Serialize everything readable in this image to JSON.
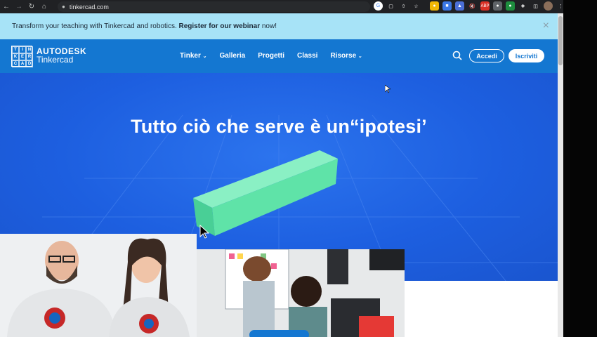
{
  "browser": {
    "url": "tinkercad.com",
    "back_icon": "arrow-left-icon",
    "forward_icon": "arrow-right-icon",
    "reload_icon": "reload-icon",
    "home_icon": "home-icon"
  },
  "banner": {
    "text_before": "Transform your teaching with Tinkercad and robotics. ",
    "link_text": "Register for our webinar",
    "text_after": " now!",
    "close_label": "×"
  },
  "navbar": {
    "logo_letters": [
      "TIN",
      "KER",
      "CAD"
    ],
    "brand_line1": "AUTODESK",
    "brand_line2": "Tinkercad",
    "menu": [
      {
        "label": "Tinker",
        "dropdown": true
      },
      {
        "label": "Galleria",
        "dropdown": false
      },
      {
        "label": "Progetti",
        "dropdown": false
      },
      {
        "label": "Classi",
        "dropdown": false
      },
      {
        "label": "Risorse",
        "dropdown": true
      }
    ],
    "login_label": "Accedi",
    "signup_label": "Iscriviti"
  },
  "hero": {
    "title": "Tutto ciò che serve è un“ipotesi’"
  },
  "colors": {
    "banner_bg": "#a7e3f7",
    "nav_bg": "#1477d1",
    "hero_bg": "#1d5fe0",
    "block_green": "#5fe3a8"
  }
}
